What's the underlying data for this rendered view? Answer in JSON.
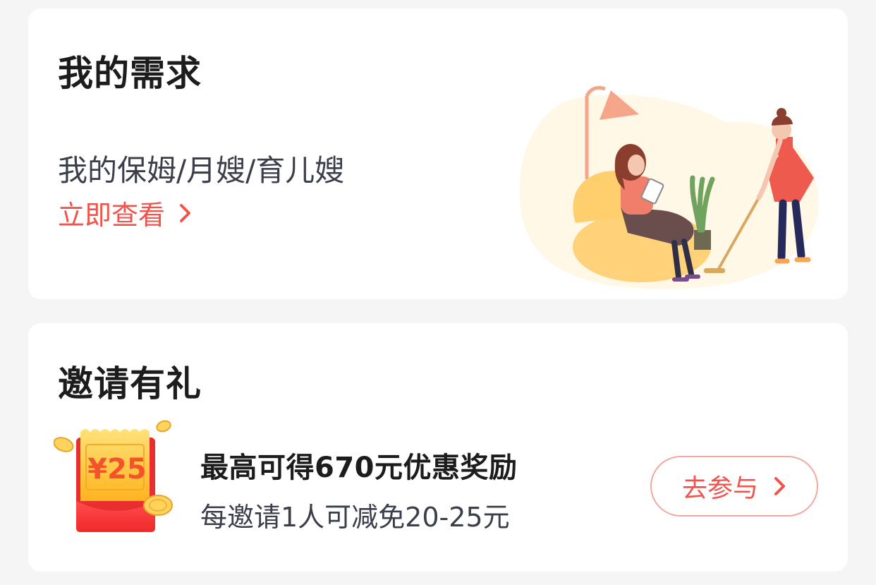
{
  "demand_card": {
    "title": "我的需求",
    "service_text": "我的保姆/月嫂/育儿嫂",
    "view_link_label": "立即查看"
  },
  "invite_card": {
    "title": "邀请有礼",
    "coupon_amount": "¥25",
    "promo_main": "最高可得670元优惠奖励",
    "promo_sub": "每邀请1人可减免20-25元",
    "join_button_label": "去参与"
  },
  "colors": {
    "accent": "#f0544c",
    "button_border": "#f2a7a2",
    "page_background": "#f5f5f5",
    "card_background": "#ffffff"
  },
  "icons": [
    "chevron-right-icon",
    "housekeeping-illustration",
    "coupon-icon",
    "gold-coin-icon"
  ]
}
